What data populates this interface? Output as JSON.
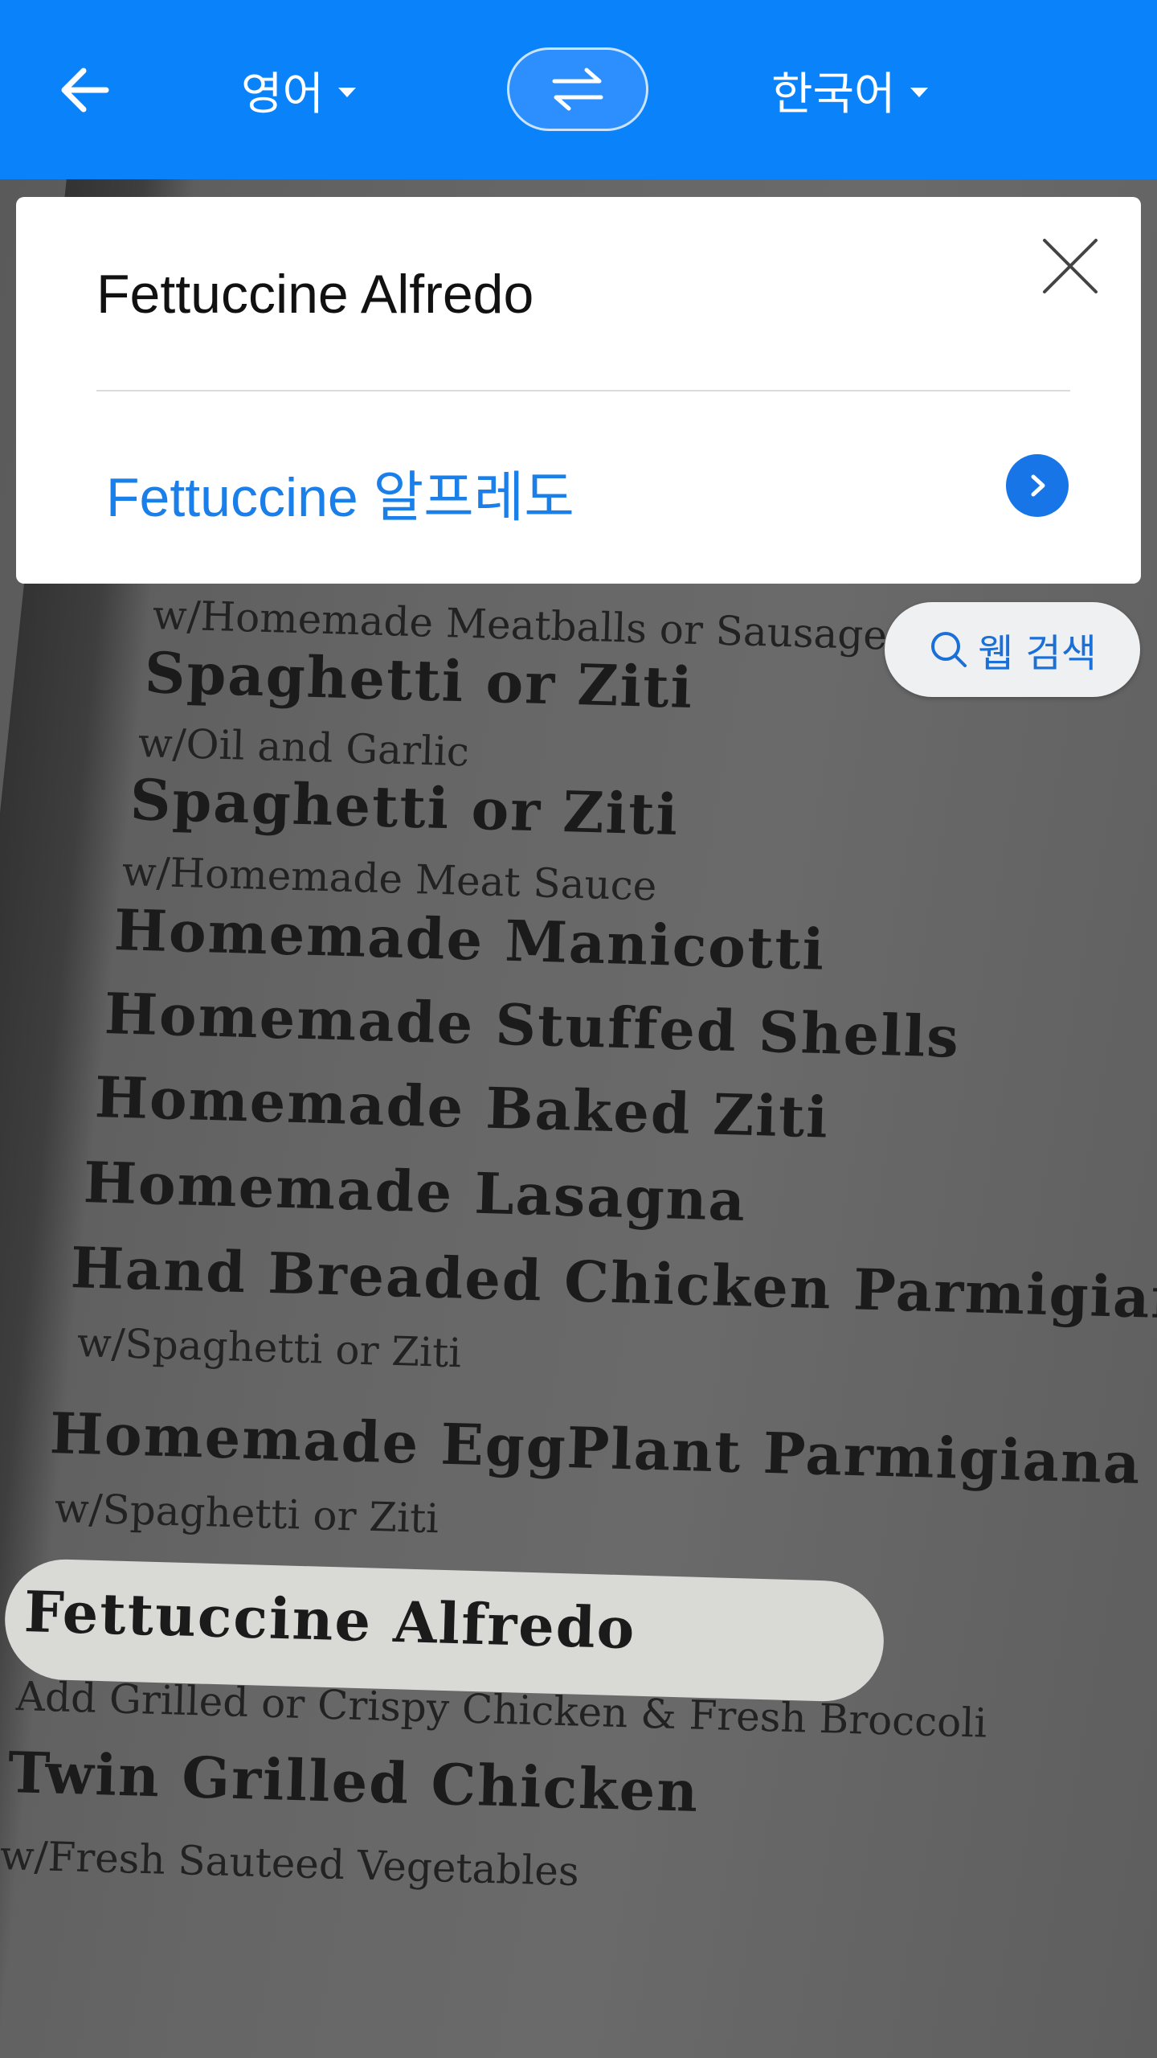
{
  "header": {
    "source_language": "영어",
    "target_language": "한국어",
    "accent_color": "#0a82fa",
    "icons": {
      "back": "arrow-left-icon",
      "swap": "swap-arrows-icon",
      "dropdown": "caret-down-icon"
    }
  },
  "result_card": {
    "source_text": "Fettuccine Alfredo",
    "translated_text": "Fettuccine 알프레도",
    "icons": {
      "close": "close-icon",
      "open": "chevron-right-icon"
    }
  },
  "web_search": {
    "label": "웹 검색",
    "icon": "search-icon"
  },
  "menu_photo": {
    "lines": [
      {
        "text": "w/Homemade Meatballs or Sausage",
        "kind": "desc"
      },
      {
        "text": "Spaghetti or Ziti",
        "kind": "item"
      },
      {
        "text": "w/Oil and Garlic",
        "kind": "desc"
      },
      {
        "text": "Spaghetti or Ziti",
        "kind": "item"
      },
      {
        "text": "w/Homemade Meat Sauce",
        "kind": "desc"
      },
      {
        "text": "Homemade Manicotti",
        "kind": "item"
      },
      {
        "text": "Homemade Stuffed Shells",
        "kind": "item"
      },
      {
        "text": "Homemade Baked Ziti",
        "kind": "item"
      },
      {
        "text": "Homemade Lasagna",
        "kind": "item"
      },
      {
        "text": "Hand Breaded Chicken Parmigiana",
        "kind": "item"
      },
      {
        "text": "w/Spaghetti or Ziti",
        "kind": "desc"
      },
      {
        "text": "Homemade EggPlant Parmigiana",
        "kind": "item"
      },
      {
        "text": "w/Spaghetti or Ziti",
        "kind": "desc"
      },
      {
        "text": "Fettuccine Alfredo",
        "kind": "item",
        "highlighted": true
      },
      {
        "text": "Add Grilled or Crispy Chicken & Fresh Broccoli",
        "kind": "desc"
      },
      {
        "text": "Twin Grilled Chicken",
        "kind": "item"
      },
      {
        "text": "w/Fresh Sauteed Vegetables",
        "kind": "desc"
      }
    ]
  }
}
